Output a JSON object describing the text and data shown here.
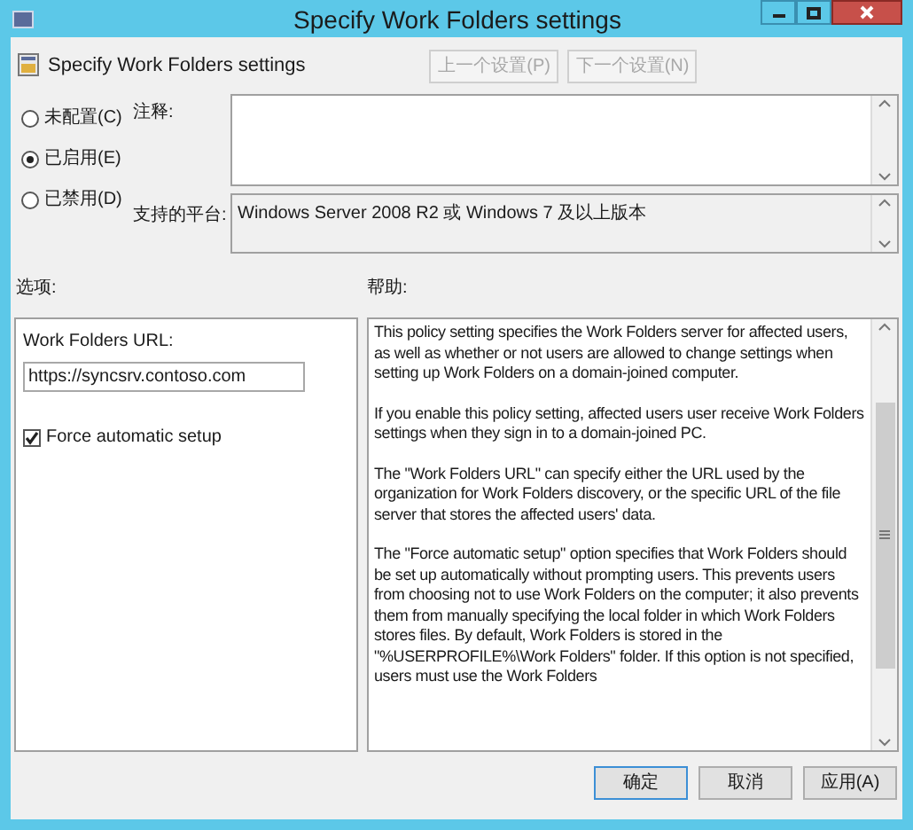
{
  "window": {
    "title": "Specify Work Folders settings"
  },
  "header": {
    "title": "Specify Work Folders settings"
  },
  "nav_buttons": [
    {
      "label": "上一个设置(P)",
      "disabled": true
    },
    {
      "label": "下一个设置(N)",
      "disabled": true
    }
  ],
  "states": [
    {
      "label": "未配置(C)",
      "selected": false
    },
    {
      "label": "已启用(E)",
      "selected": true
    },
    {
      "label": "已禁用(D)",
      "selected": false
    }
  ],
  "comment": {
    "label": "注释:"
  },
  "platform": {
    "label": "支持的平台:",
    "value": "Windows Server 2008 R2 或 Windows 7 及以上版本"
  },
  "options": {
    "label": "选项:",
    "url_label": "Work Folders URL:",
    "url_value": "https://syncsrv.contoso.com",
    "checkbox": {
      "label": "Force automatic setup",
      "checked": true
    }
  },
  "help": {
    "label": "帮助:",
    "paragraphs": [
      "This policy setting specifies the Work Folders server for affected users, as well as whether or not users are allowed to change settings when setting up Work Folders on a domain-joined computer.",
      "If you enable this policy setting, affected users user receive Work Folders settings when they sign in to a domain-joined PC.",
      "The \"Work Folders URL\" can specify either the URL used by the organization for Work Folders discovery, or the specific URL of the file server that stores the affected users' data.",
      "The \"Force automatic setup\" option specifies that Work Folders should be set up automatically without prompting users. This prevents users from choosing not to use Work Folders on the computer; it also prevents them from manually specifying the local folder in which Work Folders stores files. By default, Work Folders is stored in the \"%USERPROFILE%\\Work Folders\" folder. If this option is not specified, users must use the Work Folders"
    ]
  },
  "buttons": [
    {
      "label": "确定",
      "default": true
    },
    {
      "label": "取消",
      "default": false
    },
    {
      "label": "应用(A)",
      "default": false
    }
  ]
}
